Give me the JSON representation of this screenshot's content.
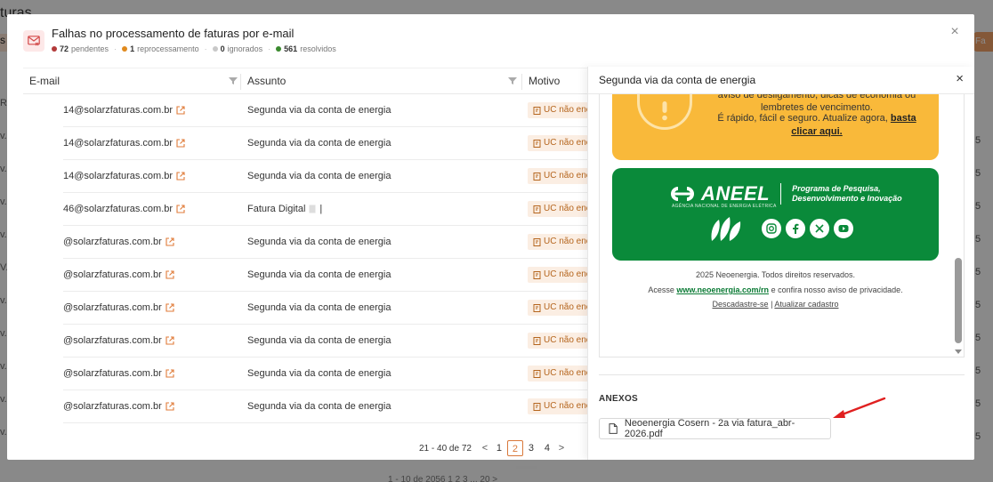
{
  "background": {
    "title": "turas",
    "right_button_label": "Fa",
    "left_tab_label": "s",
    "row_marks": [
      "R",
      "v.",
      "v.",
      "v.",
      "v.",
      "V.",
      "v.",
      "v.",
      "v.",
      "v.",
      "v."
    ],
    "right_nums": [
      "5",
      "5",
      "5",
      "5",
      "5",
      "5",
      "5",
      "5",
      "5",
      "5"
    ],
    "bottom_pager": "1 - 10 de 2056  1  2  3  ...  20  >"
  },
  "modal": {
    "title": "Falhas no processamento de faturas por e-mail",
    "stats": [
      {
        "count": "72",
        "label": "pendentes",
        "color": "#b23a3a"
      },
      {
        "count": "1",
        "label": "reprocessamento",
        "color": "#e08a1e"
      },
      {
        "count": "0",
        "label": "ignorados",
        "color": "#c8c8c8"
      },
      {
        "count": "561",
        "label": "resolvidos",
        "color": "#3a8a2e"
      }
    ],
    "close_label": "×"
  },
  "table": {
    "columns": [
      "E-mail",
      "Assunto",
      "Motivo"
    ],
    "rows": [
      {
        "email": "14@solarzfaturas.com.br",
        "subject": "Segunda via da conta de energia",
        "motivo": "UC não enco"
      },
      {
        "email": "14@solarzfaturas.com.br",
        "subject": "Segunda via da conta de energia",
        "motivo": "UC não enco"
      },
      {
        "email": "14@solarzfaturas.com.br",
        "subject": "Segunda via da conta de energia",
        "motivo": "UC não enco"
      },
      {
        "email": "46@solarzfaturas.com.br",
        "subject": "Fatura Digital",
        "subject_suffix": "|",
        "motivo": "UC não enco"
      },
      {
        "email": "@solarzfaturas.com.br",
        "subject": "Segunda via da conta de energia",
        "motivo": "UC não enco"
      },
      {
        "email": "@solarzfaturas.com.br",
        "subject": "Segunda via da conta de energia",
        "motivo": "UC não enco"
      },
      {
        "email": "@solarzfaturas.com.br",
        "subject": "Segunda via da conta de energia",
        "motivo": "UC não enco"
      },
      {
        "email": "@solarzfaturas.com.br",
        "subject": "Segunda via da conta de energia",
        "motivo": "UC não enco"
      },
      {
        "email": "@solarzfaturas.com.br",
        "subject": "Segunda via da conta de energia",
        "motivo": "UC não enco"
      },
      {
        "email": "@solarzfaturas.com.br",
        "subject": "Segunda via da conta de energia",
        "motivo": "UC não enco"
      }
    ]
  },
  "pagination": {
    "info": "21 - 40 de 72",
    "prev": "<",
    "next": ">",
    "pages": [
      "1",
      "2",
      "3",
      "4"
    ],
    "current": "2"
  },
  "panel": {
    "title": "Segunda via da conta de energia",
    "close_label": "×",
    "email_body": {
      "yellow_text1": "aviso de desligamento, dicas de economia ou lembretes de vencimento.",
      "yellow_text2": "É rápido, fácil e seguro. Atualize agora,",
      "yellow_link": "basta clicar aqui.",
      "aneel_word": "ANEEL",
      "aneel_sub": "AGÊNCIA NACIONAL DE ENERGIA ELÉTRICA",
      "aneel_prog1": "Programa de Pesquisa,",
      "aneel_prog2": "Desenvolvimento e Inovação",
      "footer_copyright": "2025 Neoenergia. Todos direitos reservados.",
      "footer_access_pre": "Acesse",
      "footer_link": "www.neoenergia.com/rn",
      "footer_access_post": "e confira nosso aviso de privacidade.",
      "footer_unsubscribe": "Descadastre-se",
      "footer_sep": "|",
      "footer_update": "Atualizar cadastro"
    },
    "attachments_label": "ANEXOS",
    "attachment_file": "Neoenergia Cosern - 2a via fatura_abr-2026.pdf"
  },
  "colors": {
    "accent": "#d9783a",
    "yellow_card": "#f9b93a",
    "green_card": "#0a8a3a",
    "arrow": "#e02020"
  }
}
